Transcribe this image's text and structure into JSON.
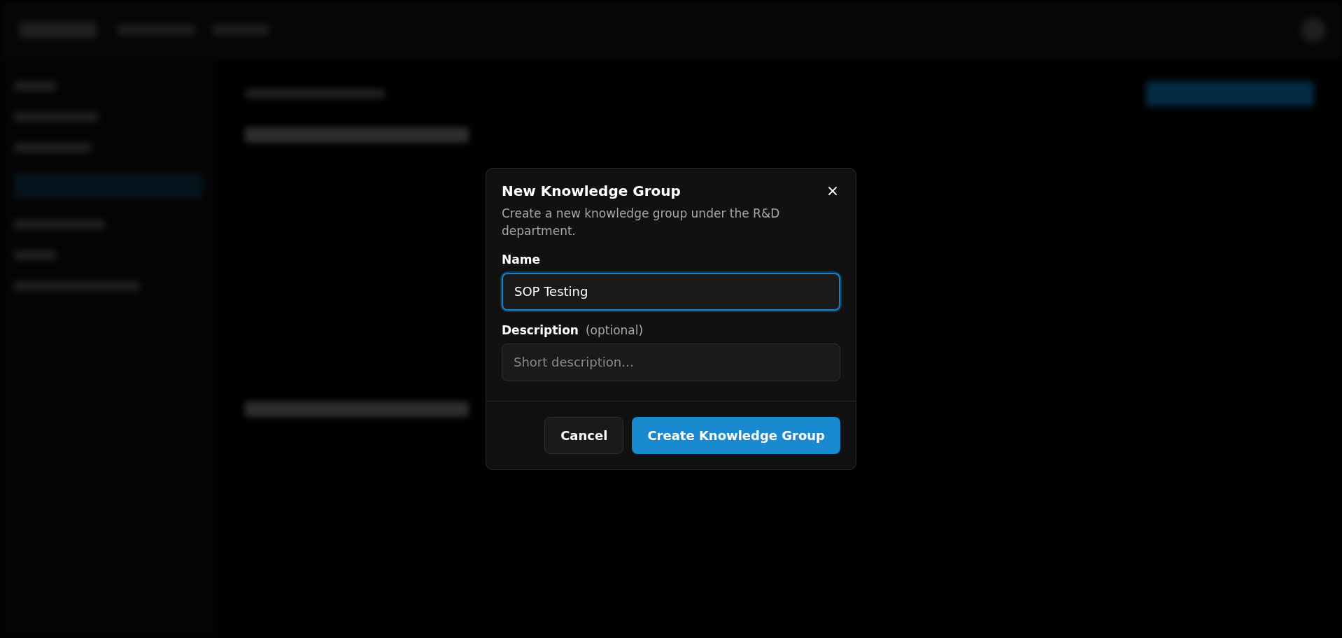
{
  "dialog": {
    "title": "New Knowledge Group",
    "description": "Create a new knowledge group under the R&D department.",
    "fields": [
      {
        "label": "Name",
        "value": "SOP Testing",
        "focused": true
      },
      {
        "label": "Description",
        "hint": "(optional)",
        "placeholder": "Short description…",
        "focused": false
      }
    ],
    "buttons": [
      {
        "label": "Cancel",
        "kind": "secondary"
      },
      {
        "label": "Create Knowledge Group",
        "kind": "primary"
      }
    ]
  }
}
